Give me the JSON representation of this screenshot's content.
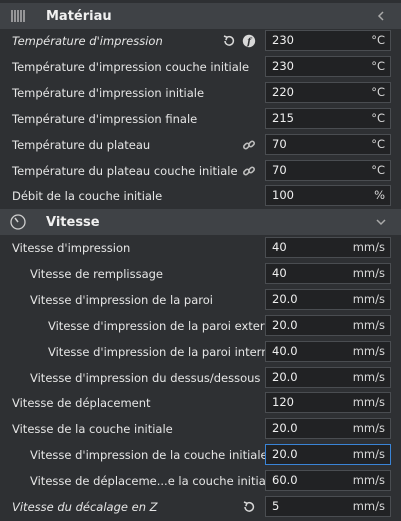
{
  "sections": {
    "material": {
      "title": "Matériau",
      "icon": "spool-icon",
      "chevron": "chevron-left-icon"
    },
    "speed": {
      "title": "Vitesse",
      "icon": "speedometer-icon",
      "chevron": "chevron-down-icon"
    }
  },
  "material_rows": [
    {
      "label": "Température d'impression",
      "value": "230",
      "unit": "°C",
      "italic": true,
      "icons": [
        "reset-icon",
        "function-icon"
      ]
    },
    {
      "label": "Température d'impression couche initiale",
      "value": "230",
      "unit": "°C"
    },
    {
      "label": "Température d'impression initiale",
      "value": "220",
      "unit": "°C"
    },
    {
      "label": "Température d'impression finale",
      "value": "215",
      "unit": "°C"
    },
    {
      "label": "Température du plateau",
      "value": "70",
      "unit": "°C",
      "icons": [
        "link-icon"
      ]
    },
    {
      "label": "Température du plateau couche initiale",
      "value": "70",
      "unit": "°C",
      "icons": [
        "link-icon"
      ]
    },
    {
      "label": "Débit de la couche initiale",
      "value": "100",
      "unit": "%"
    }
  ],
  "speed_rows": [
    {
      "label": "Vitesse d'impression",
      "value": "40",
      "unit": "mm/s"
    },
    {
      "label": "Vitesse de remplissage",
      "value": "40",
      "unit": "mm/s",
      "indent": 1
    },
    {
      "label": "Vitesse d'impression de la paroi",
      "value": "20.0",
      "unit": "mm/s",
      "indent": 1
    },
    {
      "label": "Vitesse d'impression de la paroi externe",
      "value": "20.0",
      "unit": "mm/s",
      "indent": 2
    },
    {
      "label": "Vitesse d'impression de la paroi interne",
      "value": "40.0",
      "unit": "mm/s",
      "indent": 2
    },
    {
      "label": "Vitesse d'impression du dessus/dessous",
      "value": "20.0",
      "unit": "mm/s",
      "indent": 1
    },
    {
      "label": "Vitesse de déplacement",
      "value": "120",
      "unit": "mm/s"
    },
    {
      "label": "Vitesse de la couche initiale",
      "value": "20.0",
      "unit": "mm/s"
    },
    {
      "label": "Vitesse d'impression de la couche initiale",
      "value": "20.0",
      "unit": "mm/s",
      "indent": 1,
      "active": true
    },
    {
      "label": "Vitesse de déplaceme...e la couche initiale",
      "value": "60.0",
      "unit": "mm/s",
      "indent": 1
    },
    {
      "label": "Vitesse du décalage en Z",
      "value": "5",
      "unit": "mm/s",
      "italic": true,
      "icons": [
        "reset-icon"
      ]
    }
  ],
  "colors": {
    "background": "#2e3033",
    "header": "#3f4246",
    "field": "#212224",
    "accent": "#3a84d6"
  }
}
